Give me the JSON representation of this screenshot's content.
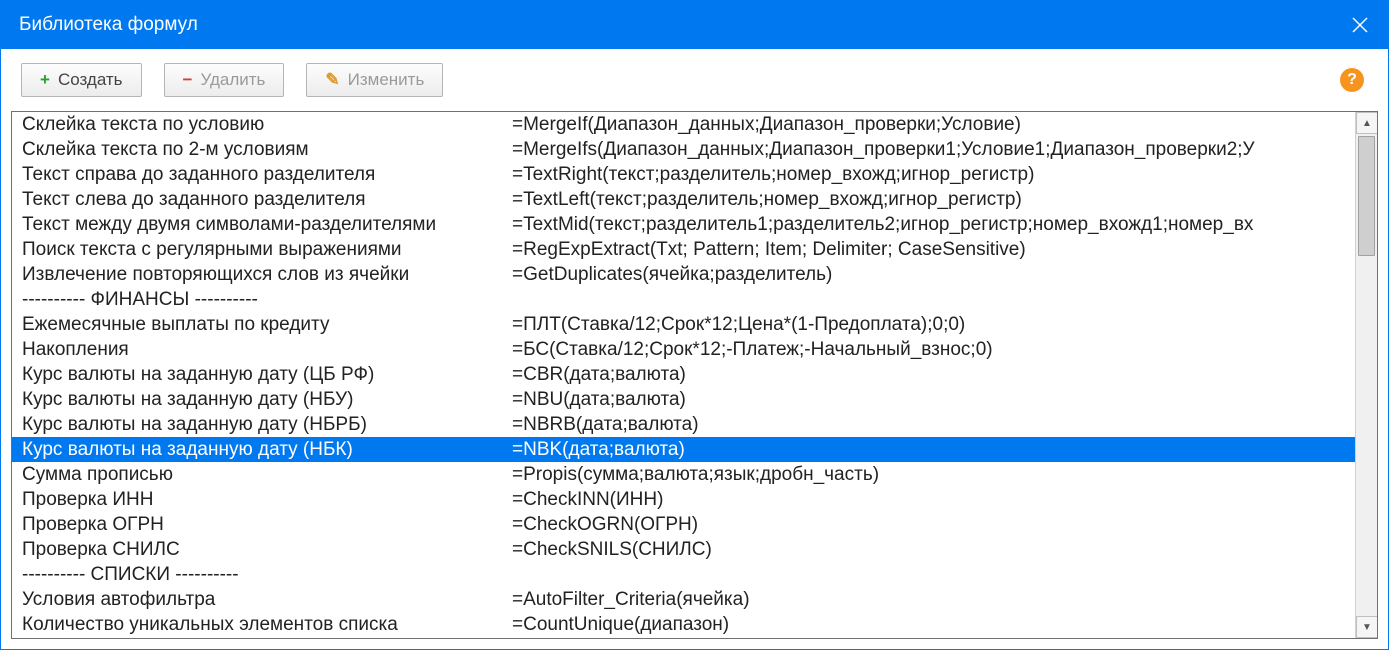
{
  "window": {
    "title": "Библиотека формул"
  },
  "toolbar": {
    "create": "Создать",
    "delete": "Удалить",
    "edit": "Изменить",
    "help_tooltip": "?"
  },
  "selected_index": 13,
  "rows": [
    {
      "name": "Склейка текста по условию",
      "formula": "=MergeIf(Диапазон_данных;Диапазон_проверки;Условие)"
    },
    {
      "name": "Склейка текста по 2-м условиям",
      "formula": "=MergeIfs(Диапазон_данных;Диапазон_проверки1;Условие1;Диапазон_проверки2;У"
    },
    {
      "name": "Текст справа до заданного разделителя",
      "formula": "=TextRight(текст;разделитель;номер_вхожд;игнор_регистр)"
    },
    {
      "name": "Текст слева до заданного разделителя",
      "formula": "=TextLeft(текст;разделитель;номер_вхожд;игнор_регистр)"
    },
    {
      "name": "Текст между двумя символами-разделителями",
      "formula": "=TextMid(текст;разделитель1;разделитель2;игнор_регистр;номер_вхожд1;номер_вх"
    },
    {
      "name": "Поиск текста с регулярными выражениями",
      "formula": "=RegExpExtract(Txt; Pattern; Item; Delimiter; CaseSensitive)"
    },
    {
      "name": "Извлечение повторяющихся слов из ячейки",
      "formula": "=GetDuplicates(ячейка;разделитель)"
    },
    {
      "name": "---------- ФИНАНСЫ ----------",
      "formula": ""
    },
    {
      "name": "Ежемесячные выплаты по кредиту",
      "formula": "=ПЛТ(Ставка/12;Срок*12;Цена*(1-Предоплата);0;0)"
    },
    {
      "name": "Накопления",
      "formula": "=БС(Ставка/12;Срок*12;-Платеж;-Начальный_взнос;0)"
    },
    {
      "name": "Курс валюты на заданную дату (ЦБ РФ)",
      "formula": "=CBR(дата;валюта)"
    },
    {
      "name": "Курс валюты на заданную дату (НБУ)",
      "formula": "=NBU(дата;валюта)"
    },
    {
      "name": "Курс валюты на заданную дату (НБРБ)",
      "formula": "=NBRB(дата;валюта)"
    },
    {
      "name": "Курс валюты на заданную дату (НБК)",
      "formula": "=NBK(дата;валюта)"
    },
    {
      "name": "Сумма прописью",
      "formula": "=Propis(сумма;валюта;язык;дробн_часть)"
    },
    {
      "name": "Проверка ИНН",
      "formula": "=CheckINN(ИНН)"
    },
    {
      "name": "Проверка ОГРН",
      "formula": "=CheckOGRN(ОГРН)"
    },
    {
      "name": "Проверка СНИЛС",
      "formula": "=CheckSNILS(СНИЛС)"
    },
    {
      "name": "---------- СПИСКИ ----------",
      "formula": ""
    },
    {
      "name": "Условия автофильтра",
      "formula": "=AutoFilter_Criteria(ячейка)"
    },
    {
      "name": "Количество уникальных элементов списка",
      "formula": "=CountUnique(диапазон)"
    }
  ]
}
